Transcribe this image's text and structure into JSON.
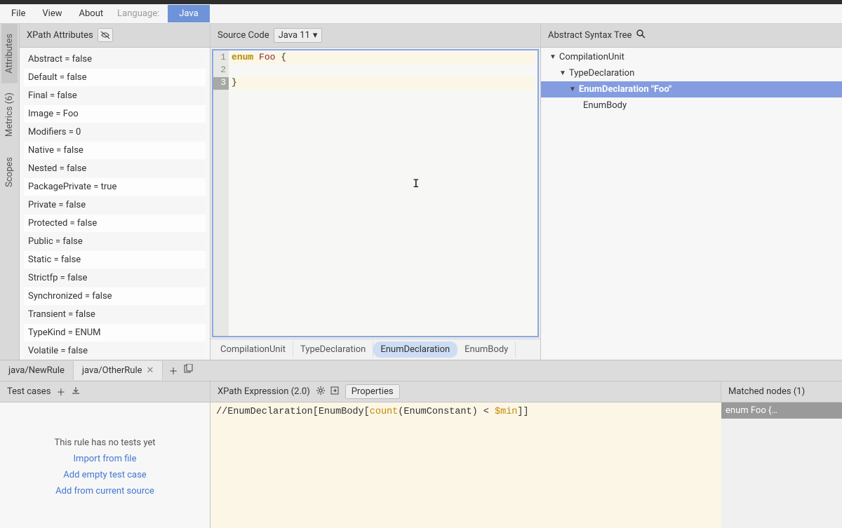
{
  "menu": {
    "file": "File",
    "view": "View",
    "about": "About",
    "languageLabel": "Language:",
    "lang": "Java"
  },
  "attrPanel": {
    "title": "XPath Attributes"
  },
  "attributes": [
    "Abstract = false",
    "Default = false",
    "Final = false",
    "Image = Foo",
    "Modifiers = 0",
    "Native = false",
    "Nested = false",
    "PackagePrivate = true",
    "Private = false",
    "Protected = false",
    "Public = false",
    "Static = false",
    "Strictfp = false",
    "Synchronized = false",
    "Transient = false",
    "TypeKind = ENUM",
    "Volatile = false"
  ],
  "vtabs": {
    "attributes": "Attributes",
    "metrics": "Metrics   (6)",
    "scopes": "Scopes"
  },
  "source": {
    "title": "Source Code",
    "version": "Java 11",
    "lines": {
      "l1a": "enum",
      "l1b": " Foo",
      "l1c": " {",
      "l2": "",
      "l3": "}"
    }
  },
  "breadcrumb": [
    "CompilationUnit",
    "TypeDeclaration",
    "EnumDeclaration",
    "EnumBody"
  ],
  "ast": {
    "title": "Abstract Syntax Tree",
    "nodes": {
      "n1": "CompilationUnit",
      "n2": "TypeDeclaration",
      "n3": "EnumDeclaration \"Foo\"",
      "n4": "EnumBody"
    }
  },
  "rules": {
    "tab1": "java/NewRule",
    "tab2": "java/OtherRule"
  },
  "bottom": {
    "testCases": "Test cases",
    "xpathTitle": "XPath Expression (2.0)",
    "propsBtn": "Properties",
    "matched": "Matched nodes (1)",
    "matchRow": "enum Foo {…",
    "noTests": "This rule has no tests yet",
    "link1": "Import from file",
    "link2": "Add empty test case",
    "link3": "Add from current source",
    "xpath": {
      "p1": "//EnumDeclaration[EnumBody[",
      "fn": "count",
      "p2": "(EnumConstant) < ",
      "vr": "$min",
      "p3": "]]"
    }
  }
}
